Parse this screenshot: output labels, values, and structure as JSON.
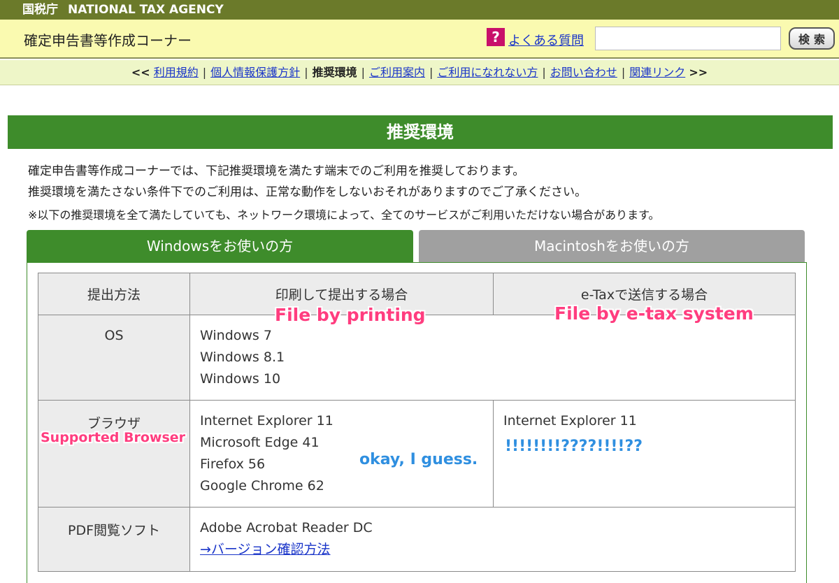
{
  "topbar": {
    "agency_jp": "国税庁",
    "agency_en": "NATIONAL TAX AGENCY"
  },
  "header": {
    "site_title": "確定申告書等作成コーナー",
    "faq_icon": "?",
    "faq_label": "よくある質問",
    "search_placeholder": "",
    "search_button": "検索"
  },
  "nav": {
    "prev_arrow": "<<",
    "next_arrow": ">>",
    "items": [
      {
        "label": "利用規約"
      },
      {
        "label": "個人情報保護方針"
      },
      {
        "label": "推奨環境"
      },
      {
        "label": "ご利用案内"
      },
      {
        "label": "ご利用になれない方"
      },
      {
        "label": "お問い合わせ"
      },
      {
        "label": "関連リンク"
      }
    ],
    "separator": "|"
  },
  "section": {
    "title": "推奨環境",
    "intro_1": "確定申告書等作成コーナーでは、下記推奨環境を満たす端末でのご利用を推奨しております。",
    "intro_2": "推奨環境を満たさない条件下でのご利用は、正常な動作をしないおそれがありますのでご了承ください。",
    "note": "※以下の推奨環境を全て満たしていても、ネットワーク環境によって、全てのサービスがご利用いただけない場合があります。"
  },
  "tabs": {
    "windows": "Windowsをお使いの方",
    "mac": "Macintoshをお使いの方"
  },
  "table": {
    "headers": [
      "提出方法",
      "印刷して提出する場合",
      "e-Taxで送信する場合"
    ],
    "rows": {
      "os": {
        "label": "OS",
        "values": [
          "Windows 7",
          "Windows 8.1",
          "Windows 10"
        ]
      },
      "browser": {
        "label": "ブラウザ",
        "print_values": [
          "Internet Explorer 11",
          "Microsoft Edge 41",
          "Firefox 56",
          "Google Chrome 62"
        ],
        "etax_values": [
          "Internet Explorer 11"
        ]
      },
      "pdf": {
        "label": "PDF閲覧ソフト",
        "value": "Adobe Acrobat Reader DC",
        "link": "→バージョン確認方法"
      }
    }
  },
  "annotations": {
    "file_printing": "File by printing",
    "file_etax": "File by e-tax system",
    "supported_browser": "Supported Browser",
    "okay": "okay, I guess.",
    "exclaim": "!!!!!!!!????!!!!??"
  },
  "colors": {
    "topbar": "#6b7a2a",
    "header_bg": "#fafab0",
    "nav_bg": "#eef6c8",
    "green": "#3e8c2b",
    "tab_inactive": "#a0a0a0",
    "link": "#1a35c9",
    "annot_pink": "#ff3d7f",
    "annot_blue": "#2f8fe0"
  }
}
